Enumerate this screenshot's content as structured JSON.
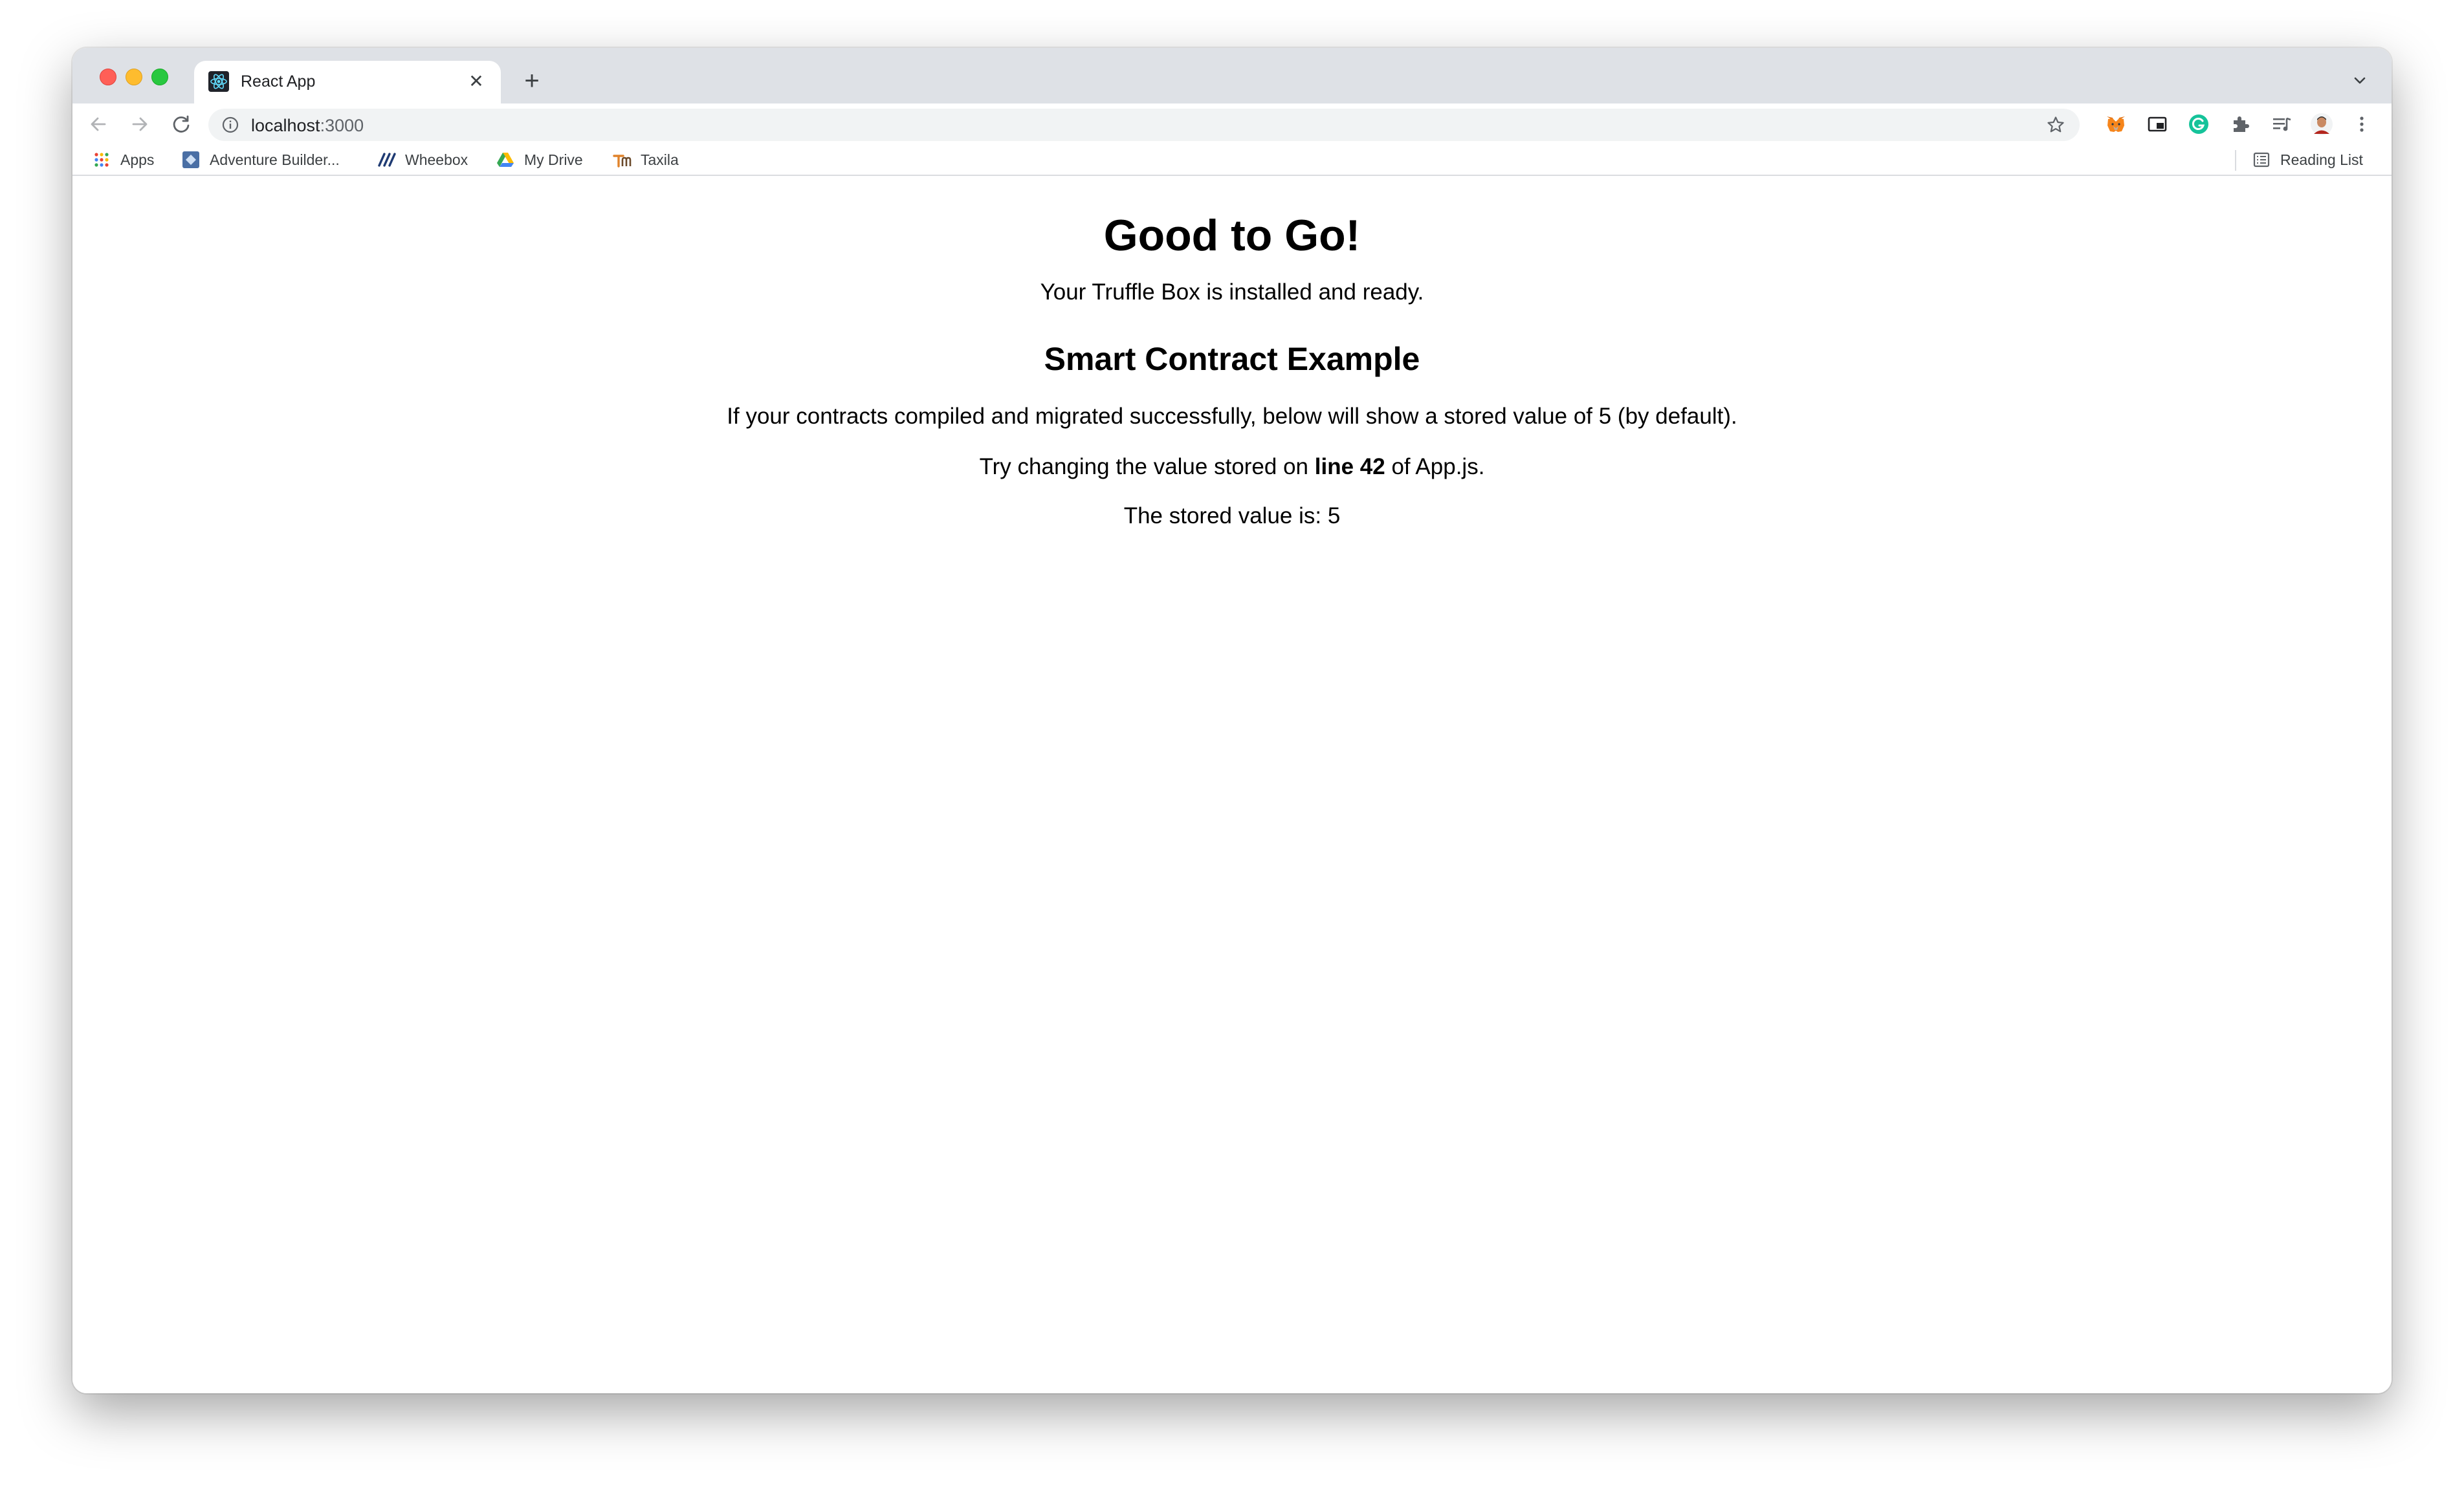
{
  "browser": {
    "tab": {
      "title": "React App",
      "close_glyph": "✕"
    },
    "new_tab_glyph": "+",
    "address": {
      "host": "localhost",
      "port": ":3000"
    },
    "bookmarks": [
      {
        "label": "Apps",
        "icon": "apps-grid-icon"
      },
      {
        "label": "Adventure Builder...",
        "icon": "adventure-builder-icon"
      },
      {
        "label": "Wheebox",
        "icon": "wheebox-icon"
      },
      {
        "label": "My Drive",
        "icon": "google-drive-icon"
      },
      {
        "label": "Taxila",
        "icon": "taxila-icon"
      }
    ],
    "reading_list": {
      "label": "Reading List",
      "icon": "reading-list-icon"
    },
    "extensions": [
      "metamask-icon",
      "picture-in-picture-icon",
      "grammarly-icon",
      "puzzle-extensions-icon",
      "media-controls-icon",
      "profile-avatar-icon",
      "kebab-menu-icon"
    ]
  },
  "page": {
    "heading": "Good to Go!",
    "subtitle": "Your Truffle Box is installed and ready.",
    "section_title": "Smart Contract Example",
    "intro": "If your contracts compiled and migrated successfully, below will show a stored value of 5 (by default).",
    "try_prefix": "Try changing the value stored on",
    "try_bold": "line 42",
    "try_suffix": "of App.js.",
    "stored_value_text": "The stored value is: 5"
  },
  "colors": {
    "tabstrip_bg": "#dee1e6",
    "omnibox_bg": "#f1f3f4",
    "close": "#ff5f57",
    "minimize": "#febc2e",
    "maximize": "#28c840",
    "grammarly": "#15c39a"
  }
}
